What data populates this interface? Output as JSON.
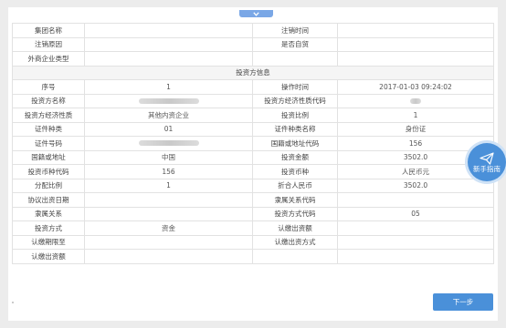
{
  "top_rows": [
    [
      "集团名称",
      "",
      "注销时间",
      ""
    ],
    [
      "注销原因",
      "",
      "是否自贸",
      ""
    ],
    [
      "外商企业类型",
      "",
      "",
      ""
    ]
  ],
  "investor_section": {
    "title": "投资方信息",
    "rows": [
      [
        "序号",
        "1",
        "操作时间",
        "2017-01-03 09:24:02"
      ],
      [
        "投资方名称",
        "",
        "投资方经济性质代码",
        ""
      ],
      [
        "投资方经济性质",
        "其他内资企业",
        "投资比例",
        "1"
      ],
      [
        "证件种类",
        "01",
        "证件种类名称",
        "身份证"
      ],
      [
        "证件号码",
        "",
        "国籍或地址代码",
        "156"
      ],
      [
        "国籍或地址",
        "中国",
        "投资金额",
        "3502.0"
      ],
      [
        "投资币种代码",
        "156",
        "投资币种",
        "人民币元"
      ],
      [
        "分配比例",
        "1",
        "折合人民币",
        "3502.0"
      ],
      [
        "协议出资日期",
        "",
        "隶属关系代码",
        ""
      ],
      [
        "隶属关系",
        "",
        "投资方式代码",
        "05"
      ],
      [
        "投资方式",
        "资金",
        "认缴出资额",
        ""
      ],
      [
        "认缴期限至",
        "",
        "认缴出资方式",
        ""
      ],
      [
        "认缴出资额",
        "",
        "",
        ""
      ]
    ]
  },
  "guide_button": {
    "label": "新手指南",
    "icon": "paper-plane-icon"
  },
  "next_button": {
    "label": "下一步"
  },
  "colors": {
    "accent": "#4a90d9",
    "border": "#e2e2e2",
    "section_bg": "#f5f5f5"
  }
}
